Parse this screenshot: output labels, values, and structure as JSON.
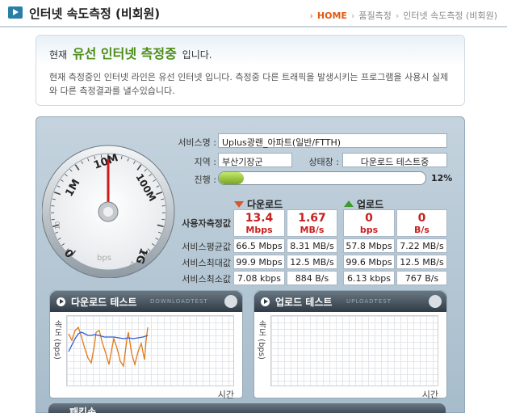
{
  "header": {
    "title": "인터넷 속도측정 (비회원)",
    "breadcrumb": [
      "HOME",
      "품질측정",
      "인터넷 속도측정 (비회원)"
    ]
  },
  "intro": {
    "prefix": "현재",
    "highlight": "유선 인터넷 측정중",
    "suffix": "입니다.",
    "desc": "현재 측정중인 인터넷 라인은 유선 인터넷 입니다. 측정중 다른 트래픽을 발생시키는 프로그램을 사용시 실제와 다른 측정결과를 낼수있습니다."
  },
  "gauge": {
    "labels": [
      "1M",
      "10M",
      "100M",
      "1G",
      "10",
      "0",
      "1M",
      "bps"
    ]
  },
  "info": {
    "service_label": "서비스명 :",
    "service_value": "Uplus광랜_아파트(일반/FTTH)",
    "region_label": "지역 :",
    "region_value": "부산기장군",
    "status_label": "상태창 :",
    "status_value": "다운로드 테스트중",
    "progress_label": "진행 :",
    "progress_value": 12,
    "progress_text": "12%"
  },
  "results": {
    "download_title": "다운로드",
    "upload_title": "업로드",
    "user_label": "사용자측정값",
    "avg_label": "서비스평균값",
    "max_label": "서비스최대값",
    "min_label": "서비스최소값",
    "dl_user_mbps": "13.4",
    "dl_user_mbps_unit": "Mbps",
    "dl_user_mBs": "1.67",
    "dl_user_mBs_unit": "MB/s",
    "ul_user_bps": "0",
    "ul_user_bps_unit": "bps",
    "ul_user_Bs": "0",
    "ul_user_Bs_unit": "B/s",
    "dl_avg_1": "66.5 Mbps",
    "dl_avg_2": "8.31 MB/s",
    "ul_avg_1": "57.8 Mbps",
    "ul_avg_2": "7.22 MB/s",
    "dl_max_1": "99.9 Mbps",
    "dl_max_2": "12.5 MB/s",
    "ul_max_1": "99.6 Mbps",
    "ul_max_2": "12.5 MB/s",
    "dl_min_1": "7.08 kbps",
    "dl_min_2": "884 B/s",
    "ul_min_1": "6.13 kbps",
    "ul_min_2": "767 B/s"
  },
  "download_test": {
    "title": "다운로드 테스트",
    "en": "DOWNLOADTEST",
    "ylabel": "속도 (bps)",
    "xlabel": "시간"
  },
  "upload_test": {
    "title": "업로드 테스트",
    "en": "UPLOADTEST",
    "ylabel": "속도 (bps)",
    "xlabel": "시간"
  },
  "bottom": {
    "title": "패킷손..."
  },
  "colors": {
    "accent": "#e05a10",
    "highlight": "#4c8d16",
    "value_red": "#c62020",
    "series_orange": "#e07a1a",
    "series_blue": "#2e5fd6"
  }
}
